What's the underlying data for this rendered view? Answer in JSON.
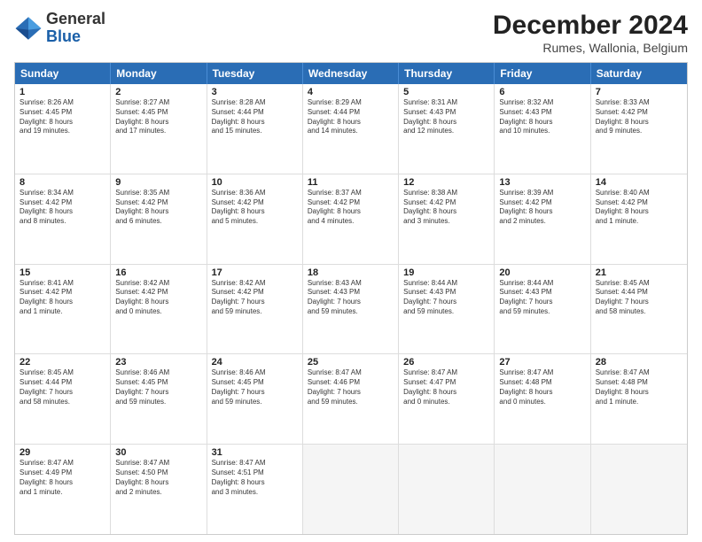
{
  "header": {
    "logo_general": "General",
    "logo_blue": "Blue",
    "month": "December 2024",
    "location": "Rumes, Wallonia, Belgium"
  },
  "days_of_week": [
    "Sunday",
    "Monday",
    "Tuesday",
    "Wednesday",
    "Thursday",
    "Friday",
    "Saturday"
  ],
  "weeks": [
    [
      {
        "day": "1",
        "info": "Sunrise: 8:26 AM\nSunset: 4:45 PM\nDaylight: 8 hours\nand 19 minutes."
      },
      {
        "day": "2",
        "info": "Sunrise: 8:27 AM\nSunset: 4:45 PM\nDaylight: 8 hours\nand 17 minutes."
      },
      {
        "day": "3",
        "info": "Sunrise: 8:28 AM\nSunset: 4:44 PM\nDaylight: 8 hours\nand 15 minutes."
      },
      {
        "day": "4",
        "info": "Sunrise: 8:29 AM\nSunset: 4:44 PM\nDaylight: 8 hours\nand 14 minutes."
      },
      {
        "day": "5",
        "info": "Sunrise: 8:31 AM\nSunset: 4:43 PM\nDaylight: 8 hours\nand 12 minutes."
      },
      {
        "day": "6",
        "info": "Sunrise: 8:32 AM\nSunset: 4:43 PM\nDaylight: 8 hours\nand 10 minutes."
      },
      {
        "day": "7",
        "info": "Sunrise: 8:33 AM\nSunset: 4:42 PM\nDaylight: 8 hours\nand 9 minutes."
      }
    ],
    [
      {
        "day": "8",
        "info": "Sunrise: 8:34 AM\nSunset: 4:42 PM\nDaylight: 8 hours\nand 8 minutes."
      },
      {
        "day": "9",
        "info": "Sunrise: 8:35 AM\nSunset: 4:42 PM\nDaylight: 8 hours\nand 6 minutes."
      },
      {
        "day": "10",
        "info": "Sunrise: 8:36 AM\nSunset: 4:42 PM\nDaylight: 8 hours\nand 5 minutes."
      },
      {
        "day": "11",
        "info": "Sunrise: 8:37 AM\nSunset: 4:42 PM\nDaylight: 8 hours\nand 4 minutes."
      },
      {
        "day": "12",
        "info": "Sunrise: 8:38 AM\nSunset: 4:42 PM\nDaylight: 8 hours\nand 3 minutes."
      },
      {
        "day": "13",
        "info": "Sunrise: 8:39 AM\nSunset: 4:42 PM\nDaylight: 8 hours\nand 2 minutes."
      },
      {
        "day": "14",
        "info": "Sunrise: 8:40 AM\nSunset: 4:42 PM\nDaylight: 8 hours\nand 1 minute."
      }
    ],
    [
      {
        "day": "15",
        "info": "Sunrise: 8:41 AM\nSunset: 4:42 PM\nDaylight: 8 hours\nand 1 minute."
      },
      {
        "day": "16",
        "info": "Sunrise: 8:42 AM\nSunset: 4:42 PM\nDaylight: 8 hours\nand 0 minutes."
      },
      {
        "day": "17",
        "info": "Sunrise: 8:42 AM\nSunset: 4:42 PM\nDaylight: 7 hours\nand 59 minutes."
      },
      {
        "day": "18",
        "info": "Sunrise: 8:43 AM\nSunset: 4:43 PM\nDaylight: 7 hours\nand 59 minutes."
      },
      {
        "day": "19",
        "info": "Sunrise: 8:44 AM\nSunset: 4:43 PM\nDaylight: 7 hours\nand 59 minutes."
      },
      {
        "day": "20",
        "info": "Sunrise: 8:44 AM\nSunset: 4:43 PM\nDaylight: 7 hours\nand 59 minutes."
      },
      {
        "day": "21",
        "info": "Sunrise: 8:45 AM\nSunset: 4:44 PM\nDaylight: 7 hours\nand 58 minutes."
      }
    ],
    [
      {
        "day": "22",
        "info": "Sunrise: 8:45 AM\nSunset: 4:44 PM\nDaylight: 7 hours\nand 58 minutes."
      },
      {
        "day": "23",
        "info": "Sunrise: 8:46 AM\nSunset: 4:45 PM\nDaylight: 7 hours\nand 59 minutes."
      },
      {
        "day": "24",
        "info": "Sunrise: 8:46 AM\nSunset: 4:45 PM\nDaylight: 7 hours\nand 59 minutes."
      },
      {
        "day": "25",
        "info": "Sunrise: 8:47 AM\nSunset: 4:46 PM\nDaylight: 7 hours\nand 59 minutes."
      },
      {
        "day": "26",
        "info": "Sunrise: 8:47 AM\nSunset: 4:47 PM\nDaylight: 8 hours\nand 0 minutes."
      },
      {
        "day": "27",
        "info": "Sunrise: 8:47 AM\nSunset: 4:48 PM\nDaylight: 8 hours\nand 0 minutes."
      },
      {
        "day": "28",
        "info": "Sunrise: 8:47 AM\nSunset: 4:48 PM\nDaylight: 8 hours\nand 1 minute."
      }
    ],
    [
      {
        "day": "29",
        "info": "Sunrise: 8:47 AM\nSunset: 4:49 PM\nDaylight: 8 hours\nand 1 minute."
      },
      {
        "day": "30",
        "info": "Sunrise: 8:47 AM\nSunset: 4:50 PM\nDaylight: 8 hours\nand 2 minutes."
      },
      {
        "day": "31",
        "info": "Sunrise: 8:47 AM\nSunset: 4:51 PM\nDaylight: 8 hours\nand 3 minutes."
      },
      {
        "day": "",
        "info": ""
      },
      {
        "day": "",
        "info": ""
      },
      {
        "day": "",
        "info": ""
      },
      {
        "day": "",
        "info": ""
      }
    ]
  ]
}
